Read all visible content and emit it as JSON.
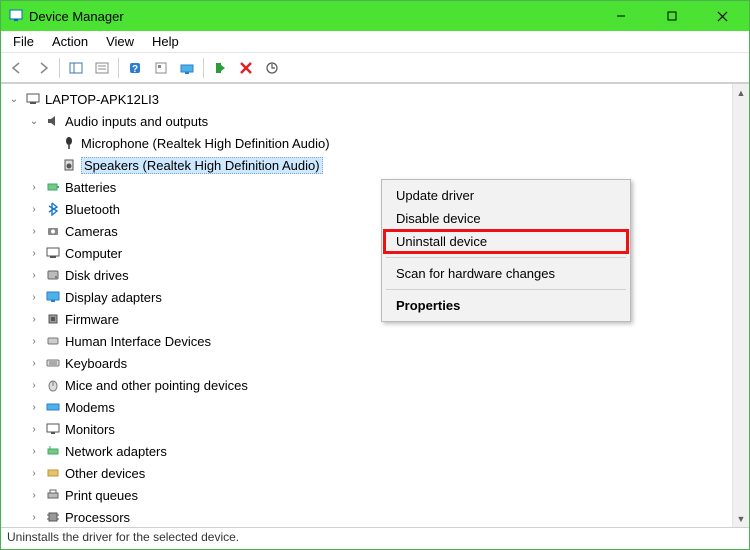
{
  "window": {
    "title": "Device Manager"
  },
  "menubar": [
    "File",
    "Action",
    "View",
    "Help"
  ],
  "tree": {
    "root": "LAPTOP-APK12LI3",
    "audio": {
      "label": "Audio inputs and outputs",
      "children": [
        "Microphone (Realtek High Definition Audio)",
        "Speakers (Realtek High Definition Audio)"
      ]
    },
    "categories": [
      "Batteries",
      "Bluetooth",
      "Cameras",
      "Computer",
      "Disk drives",
      "Display adapters",
      "Firmware",
      "Human Interface Devices",
      "Keyboards",
      "Mice and other pointing devices",
      "Modems",
      "Monitors",
      "Network adapters",
      "Other devices",
      "Print queues",
      "Processors"
    ]
  },
  "context_menu": {
    "items": [
      "Update driver",
      "Disable device",
      "Uninstall device",
      "Scan for hardware changes",
      "Properties"
    ]
  },
  "statusbar": "Uninstalls the driver for the selected device."
}
